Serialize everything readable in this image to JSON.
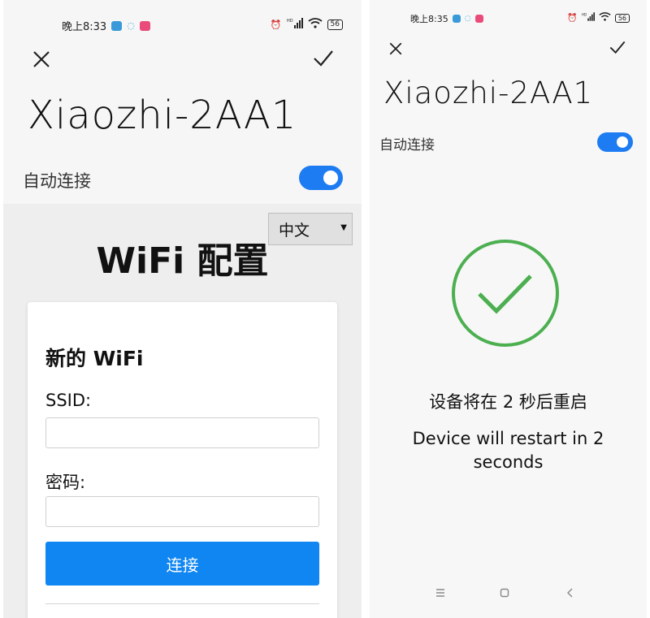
{
  "left_screen": {
    "status": {
      "time": "晚上8:33",
      "battery": "56"
    },
    "device_name": "Xiaozhi-2AA1",
    "auto_connect_label": "自动连接",
    "auto_connect_on": true,
    "web": {
      "language_selected": "中文",
      "heading": "WiFi 配置",
      "card_title": "新的 WiFi",
      "ssid_label": "SSID:",
      "ssid_value": "",
      "password_label": "密码:",
      "password_value": "",
      "connect_label": "连接"
    }
  },
  "right_screen": {
    "status": {
      "time": "晚上8:35",
      "battery": "56"
    },
    "device_name": "Xiaozhi-2AA1",
    "auto_connect_label": "自动连接",
    "auto_connect_on": true,
    "restart_message_cn": "设备将在 2 秒后重启",
    "restart_message_en": "Device will restart in 2 seconds"
  },
  "colors": {
    "toggle_on": "#1e7cf2",
    "primary_button": "#0f86f2",
    "success_green": "#4caf50"
  },
  "icons": {
    "close": "close-icon",
    "confirm": "check-icon",
    "success": "success-check-icon",
    "alarm": "alarm-icon",
    "signal": "signal-icon",
    "wifi": "wifi-icon",
    "nav_menu": "menu-icon",
    "nav_home": "home-icon",
    "nav_back": "back-icon"
  }
}
